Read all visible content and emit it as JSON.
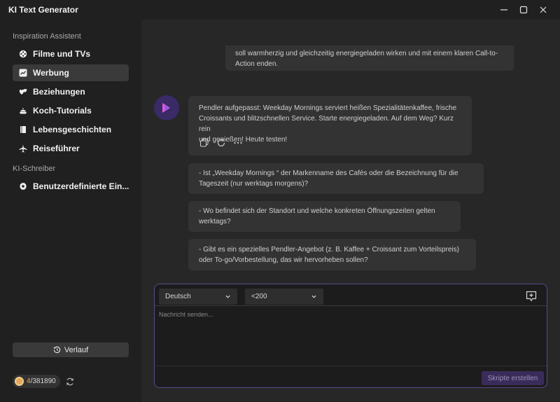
{
  "window": {
    "title": "KI Text Generator"
  },
  "sidebar": {
    "section_inspiration": "Inspiration Assistent",
    "items": [
      {
        "label": "Filme und TVs",
        "icon": "film-reel-icon"
      },
      {
        "label": "Werbung",
        "icon": "trend-chart-icon",
        "active": true
      },
      {
        "label": "Beziehungen",
        "icon": "hearts-icon"
      },
      {
        "label": "Koch-Tutorials",
        "icon": "cooking-pot-icon"
      },
      {
        "label": "Lebensgeschichten",
        "icon": "book-icon"
      },
      {
        "label": "Reiseführer",
        "icon": "airplane-icon"
      }
    ],
    "section_writer": "KI-Schreiber",
    "writer_items": [
      {
        "label": "Benutzerdefinierte Ein...",
        "icon": "gear-icon"
      }
    ],
    "history_label": "Verlauf",
    "credits_used": "4",
    "credits_total": "/381890"
  },
  "chat": {
    "prev_request_line1": "soll warmherzig und gleichzeitig energiegeladen wirken und mit einem klaren Call-to-",
    "prev_request_line2": "Action enden.",
    "response_line1": "Pendler aufgepasst: Weekday Mornings serviert heißen Spezialitätenkaffee, frische",
    "response_line2": "Croissants und blitzschnellen Service. Starte energiegeladen. Auf dem Weg? Kurz rein",
    "response_line3": "und genießen! Heute testen!",
    "suggestions": [
      {
        "line1": "- Ist „Weekday Mornings “ der Markenname des Cafés oder die Bezeichnung für die",
        "line2": "Tageszeit (nur werktags morgens)?"
      },
      {
        "line1": "- Wo befindet sich der Standort und welche konkreten Öffnungszeiten gelten",
        "line2": "werktags?"
      },
      {
        "line1": "- Gibt es ein spezielles Pendler-Angebot (z. B. Kaffee + Croissant zum Vorteilspreis)",
        "line2": "oder To-go/Vorbestellung, das wir hervorheben sollen?"
      }
    ]
  },
  "composer": {
    "language": "Deutsch",
    "length": "<200",
    "placeholder": "Nachricht senden...",
    "submit_label": "Skripte erstellen"
  },
  "colors": {
    "accent": "#5a4a8a",
    "credit": "#e9a75a"
  }
}
